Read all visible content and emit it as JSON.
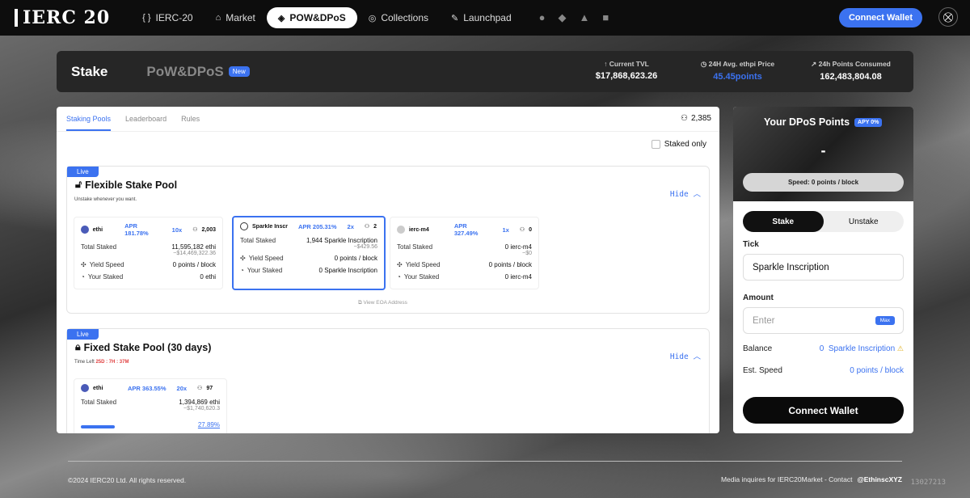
{
  "nav": {
    "logo": "IERC 20",
    "items": [
      {
        "icon": "{ }",
        "label": "IERC-20"
      },
      {
        "icon": "⌂",
        "label": "Market"
      },
      {
        "icon": "◈",
        "label": "POW&DPoS"
      },
      {
        "icon": "◎",
        "label": "Collections"
      },
      {
        "icon": "✎",
        "label": "Launchpad"
      }
    ],
    "social": [
      "github-icon",
      "gitbook-icon",
      "twitter-icon",
      "discord-icon"
    ],
    "connect": "Connect Wallet"
  },
  "header": {
    "stake": "Stake",
    "dpos": "PoW&DPoS",
    "new_badge": "New",
    "stats": [
      {
        "label": "Current TVL",
        "value": "$17,868,623.26"
      },
      {
        "label": "24H Avg. ethpi Price",
        "value": "45.45points"
      },
      {
        "label": "24h Points Consumed",
        "value": "162,483,804.08"
      }
    ]
  },
  "tabs": [
    "Staking Pools",
    "Leaderboard",
    "Rules"
  ],
  "users_count": "2,385",
  "staked_only": "Staked only",
  "pool1": {
    "live": "Live",
    "title": "Flexible Stake Pool",
    "sub": "Unstake whenever you want.",
    "hide": "Hide",
    "eoa": "View EOA Address",
    "cards": [
      {
        "token": "ethi",
        "apr": "APR 181.78%",
        "mult": "10x",
        "users": "2,003",
        "total_label": "Total Staked",
        "total": "11,595,182 ethi",
        "usd": "~$14,469,322.36",
        "yield_label": "Yield Speed",
        "yield": "0 points / block",
        "your_label": "Your Staked",
        "your": "0 ethi"
      },
      {
        "token": "Sparkle Inscr",
        "apr": "APR 205.31%",
        "mult": "2x",
        "users": "2",
        "total_label": "Total Staked",
        "total": "1,944 Sparkle Inscription",
        "usd": "~$429.56",
        "yield_label": "Yield Speed",
        "yield": "0 points / block",
        "your_label": "Your Staked",
        "your": "0 Sparkle Inscription"
      },
      {
        "token": "ierc-m4",
        "apr": "APR 327.49%",
        "mult": "1x",
        "users": "0",
        "total_label": "Total Staked",
        "total": "0 ierc-m4",
        "usd": "~$0",
        "yield_label": "Yield Speed",
        "yield": "0 points / block",
        "your_label": "Your Staked",
        "your": "0 ierc-m4"
      }
    ]
  },
  "pool2": {
    "live": "Live",
    "title": "Fixed Stake Pool (30 days)",
    "time_label": "Time Left",
    "time": "25D : 7H : 37M",
    "hide": "Hide",
    "card": {
      "token": "ethi",
      "apr": "APR 363.55%",
      "mult": "20x",
      "users": "97",
      "total_label": "Total Staked",
      "total": "1,394,869 ethi",
      "usd": "~$1,740,620.3",
      "pct": "27.89%",
      "progress": 0.2789
    }
  },
  "right": {
    "title": "Your DPoS Points",
    "apy": "APY 0%",
    "points": "-",
    "speed": "Speed: 0 points / block",
    "stake": "Stake",
    "unstake": "Unstake",
    "tick_label": "Tick",
    "tick_value": "Sparkle Inscription",
    "amount_label": "Amount",
    "amount_placeholder": "Enter",
    "max": "Max",
    "balance_label": "Balance",
    "balance_num": "0",
    "balance_token": "Sparkle Inscription",
    "est_label": "Est. Speed",
    "est_value": "0 points / block",
    "connect": "Connect Wallet"
  },
  "footer": {
    "copyright": "©2024 IERC20 Ltd. All rights reserved.",
    "media": "Media inquires for IERC20Market - Contact",
    "handle": "@EthinscXYZ",
    "watermark": "13027213"
  }
}
